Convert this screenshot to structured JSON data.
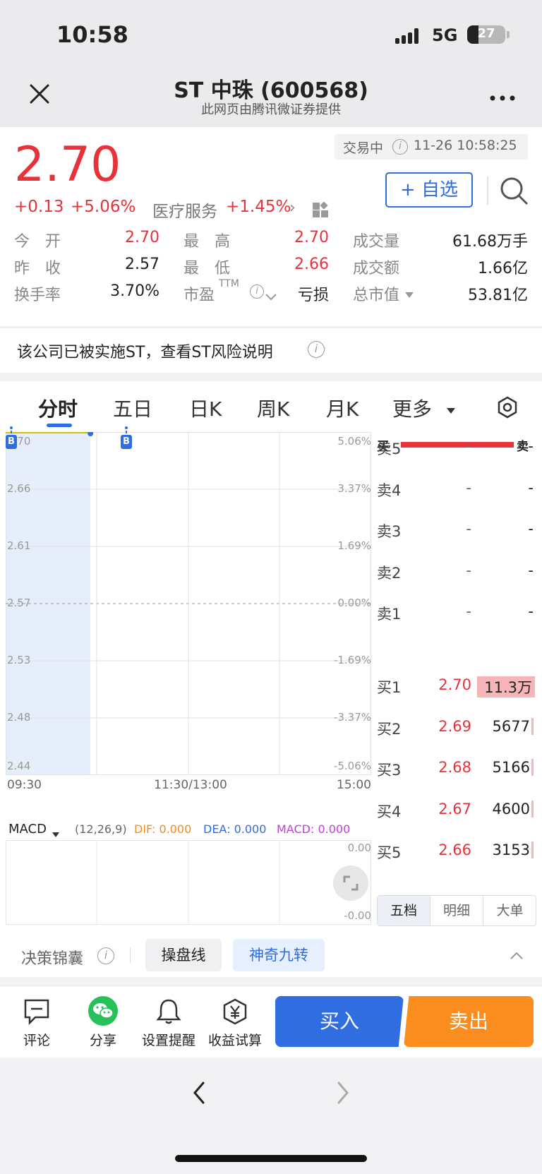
{
  "status_bar": {
    "time": "10:58",
    "network": "5G",
    "battery": "27"
  },
  "nav": {
    "title": "ST 中珠 (600568)",
    "subtitle": "此网页由腾讯微证券提供"
  },
  "quote": {
    "price": "2.70",
    "change": "+0.13",
    "change_pct": "+5.06%",
    "sector_name": "医疗服务",
    "sector_pct": "+1.45%",
    "trade_status": "交易中",
    "datetime": "11-26 10:58:25",
    "watch_button": "+ 自选"
  },
  "stats": [
    {
      "label": "今　开",
      "value": "2.70",
      "color": "#e8323a"
    },
    {
      "label": "最　高",
      "value": "2.70",
      "color": "#e8323a"
    },
    {
      "label": "成交量",
      "value": "61.68万手",
      "color": "#222222"
    },
    {
      "label": "昨　收",
      "value": "2.57",
      "color": "#222222"
    },
    {
      "label": "最　低",
      "value": "2.66",
      "color": "#e8323a"
    },
    {
      "label": "成交额",
      "value": "1.66亿",
      "color": "#222222"
    },
    {
      "label": "换手率",
      "value": "3.70%",
      "color": "#222222"
    },
    {
      "label": "市盈",
      "label_sup": "TTM",
      "value": "亏损",
      "color": "#222222"
    },
    {
      "label": "总市值",
      "value": "53.81亿",
      "color": "#222222"
    }
  ],
  "notice": "该公司已被实施ST，查看ST风险说明",
  "tabs": [
    "分时",
    "五日",
    "日K",
    "周K",
    "月K",
    "更多"
  ],
  "chart": {
    "price_ticks": [
      "2.70",
      "2.66",
      "2.61",
      "2.57",
      "2.53",
      "2.48",
      "2.44"
    ],
    "pct_ticks": [
      "5.06%",
      "3.37%",
      "1.69%",
      "0.00%",
      "-1.69%",
      "-3.37%",
      "-5.06%"
    ],
    "time_ticks": [
      "09:30",
      "11:30/13:00",
      "15:00"
    ],
    "markers": [
      "B",
      "B"
    ],
    "progress_fraction": 0.12
  },
  "macd": {
    "name": "MACD",
    "params": "(12,26,9)",
    "dif_label": "DIF: 0.000",
    "dea_label": "DEA: 0.000",
    "macd_label": "MACD: 0.000",
    "top": "0.00",
    "bottom": "-0.00",
    "colors": {
      "dif": "#f08c1e",
      "dea": "#2f6de0",
      "macd": "#c23fd6"
    }
  },
  "orderbook": {
    "buy_label": "买",
    "sell_label": "卖",
    "asks": [
      {
        "label": "卖5",
        "price": "-",
        "vol": "-"
      },
      {
        "label": "卖4",
        "price": "-",
        "vol": "-"
      },
      {
        "label": "卖3",
        "price": "-",
        "vol": "-"
      },
      {
        "label": "卖2",
        "price": "-",
        "vol": "-"
      },
      {
        "label": "卖1",
        "price": "-",
        "vol": "-"
      }
    ],
    "bids": [
      {
        "label": "买1",
        "price": "2.70",
        "vol": "11.3万"
      },
      {
        "label": "买2",
        "price": "2.69",
        "vol": "5677"
      },
      {
        "label": "买3",
        "price": "2.68",
        "vol": "5166"
      },
      {
        "label": "买4",
        "price": "2.67",
        "vol": "4600"
      },
      {
        "label": "买5",
        "price": "2.66",
        "vol": "3153"
      }
    ],
    "tabs": [
      "五档",
      "明细",
      "大单"
    ]
  },
  "tools": {
    "label": "决策锦囊",
    "btn1": "操盘线",
    "btn2": "神奇九转"
  },
  "bottom": {
    "comment": "评论",
    "share": "分享",
    "alert": "设置提醒",
    "calc": "收益试算",
    "buy": "买入",
    "sell": "卖出"
  },
  "colors": {
    "red": "#e8323a",
    "blue": "#2f6de0",
    "orange": "#fb8c1e"
  }
}
